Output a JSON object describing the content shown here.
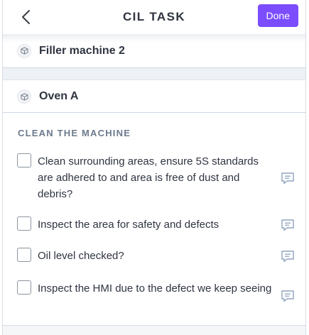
{
  "header": {
    "title": "CIL TASK",
    "done_label": "Done",
    "back_icon": "chevron-left-icon"
  },
  "machines": [
    {
      "name": "Filler machine 2",
      "icon": "cube-icon"
    },
    {
      "name": "Oven A",
      "icon": "cube-icon"
    }
  ],
  "section": {
    "title": "CLEAN THE MACHINE",
    "tasks": [
      {
        "text": "Clean surrounding areas, ensure 5S standards are adhered to and area is free of dust and debris?",
        "checked": false
      },
      {
        "text": "Inspect the area for safety and defects",
        "checked": false
      },
      {
        "text": "Oil level checked?",
        "checked": false
      },
      {
        "text": "Inspect the HMI due to the defect we keep seeing",
        "checked": false
      }
    ]
  },
  "colors": {
    "accent": "#7b4dff",
    "comment_icon": "#8fa3bf"
  }
}
